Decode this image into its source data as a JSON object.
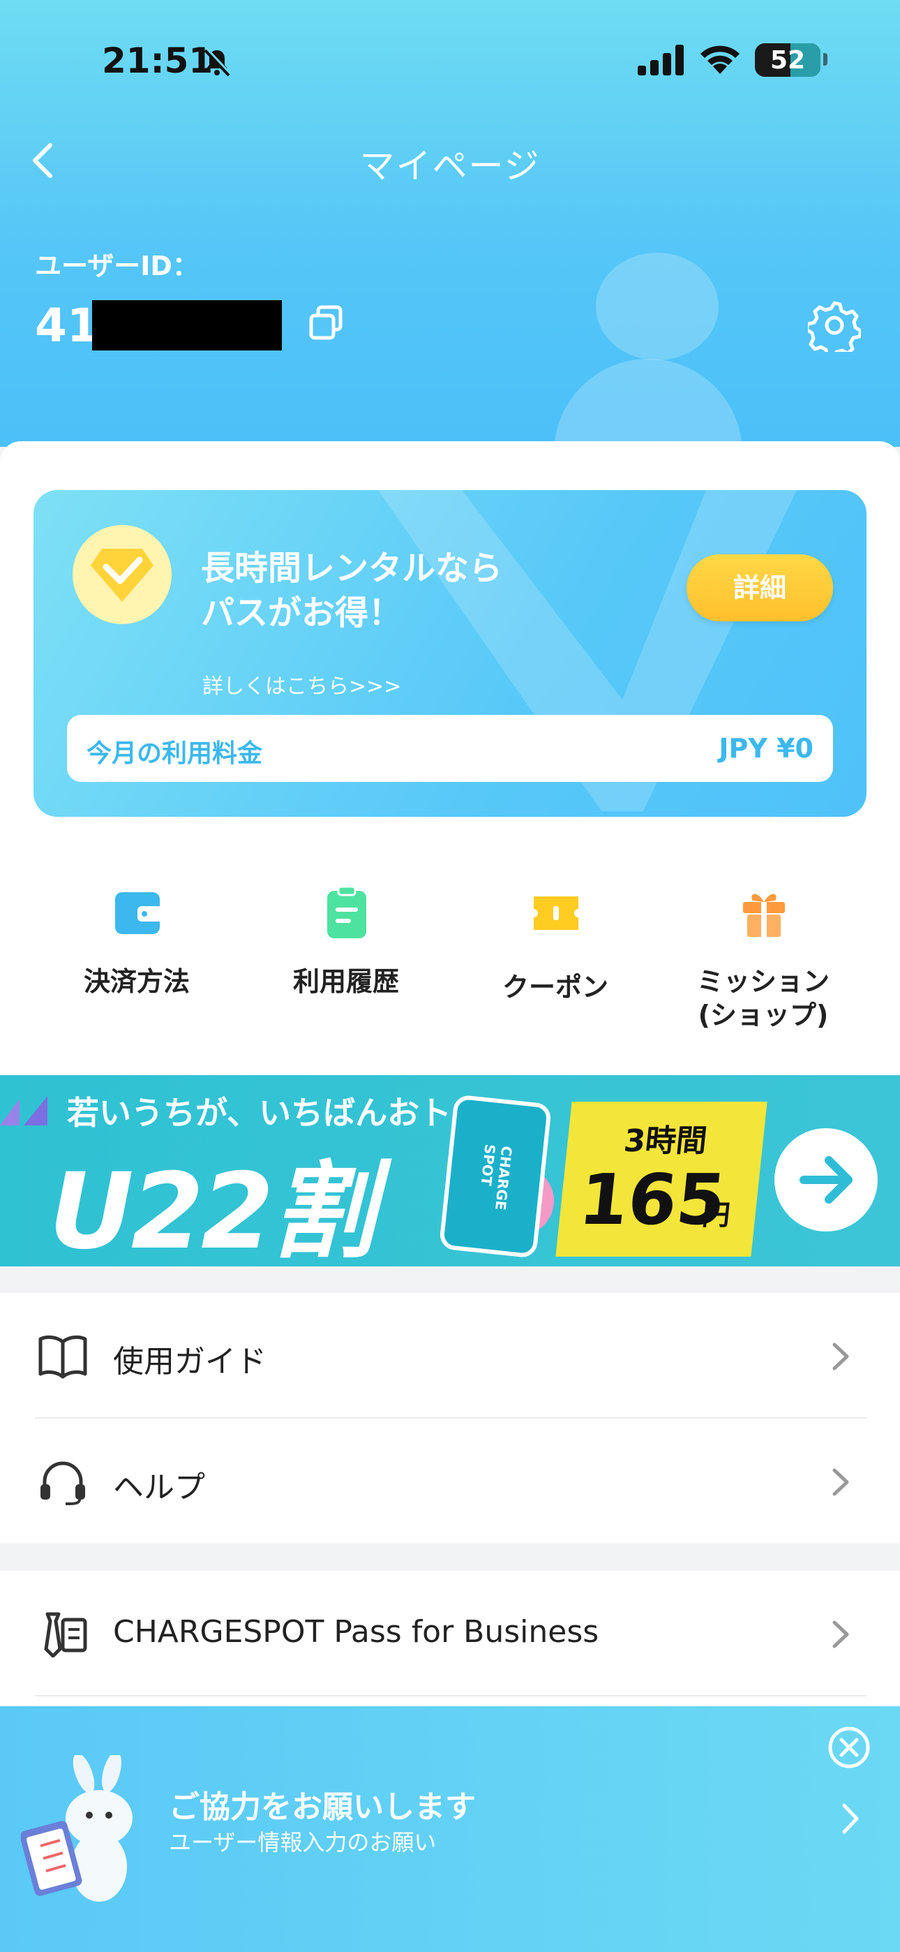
{
  "status_bar": {
    "time": "21:51",
    "battery": "52"
  },
  "header": {
    "title": "マイページ",
    "user_id_label": "ユーザーID：",
    "user_id_visible": "41"
  },
  "pass_card": {
    "title": "長時間レンタルなら\nパスがお得！",
    "link": "詳しくはこちら>>>",
    "detail_button": "詳細",
    "fee_label": "今月の利用料金",
    "fee_value": "JPY ¥0"
  },
  "quick_actions": [
    {
      "label": "決済方法",
      "icon": "wallet-icon",
      "color": "#3cb8ee"
    },
    {
      "label": "利用履歴",
      "icon": "clipboard-icon",
      "color": "#4ee2a0"
    },
    {
      "label": "クーポン",
      "icon": "ticket-icon",
      "color": "#ffcc22"
    },
    {
      "label": "ミッション\n(ショップ)",
      "icon": "gift-icon",
      "color": "#ff9a3c"
    }
  ],
  "banner": {
    "subtitle": "若いうちが、いちばんおトク。",
    "headline": "U22割",
    "phone_text": "CHARGE SPOT",
    "price_header": "3時間",
    "price_number": "165",
    "price_unit": "円"
  },
  "menu_group_1": [
    {
      "label": "使用ガイド",
      "icon": "book-icon"
    },
    {
      "label": "ヘルプ",
      "icon": "headset-icon"
    }
  ],
  "menu_group_2": [
    {
      "label": "CHARGESPOT Pass for Business",
      "icon": "business-icon"
    }
  ],
  "popup": {
    "title": "ご協力をお願いします",
    "subtitle": "ユーザー情報入力のお願い"
  },
  "colors": {
    "accent": "#3cb8ee",
    "header": "#55c6f7",
    "detail_button": "#ffc82e"
  }
}
